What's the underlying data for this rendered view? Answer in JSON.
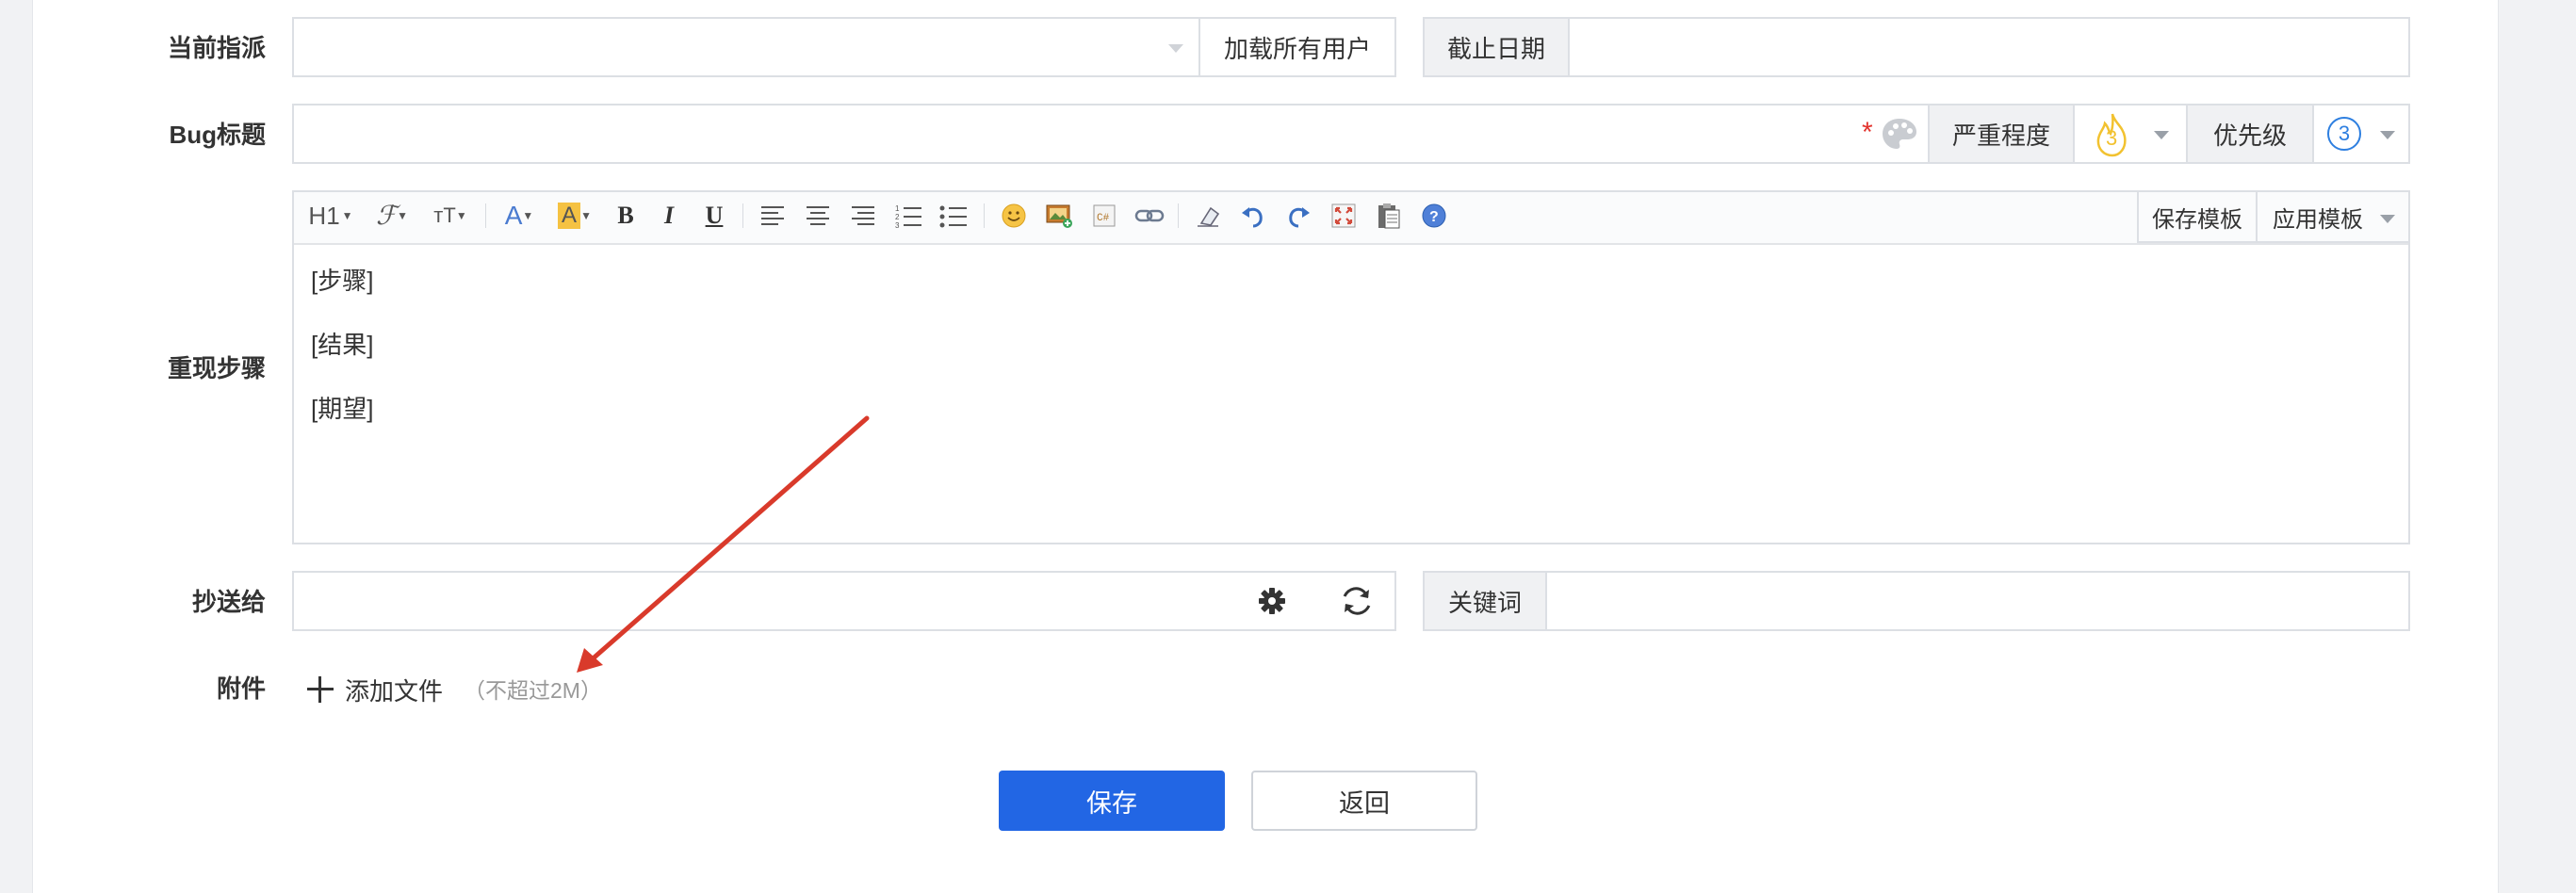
{
  "colors": {
    "primary": "#2266e4",
    "required": "#e2322c",
    "annotation_arrow": "#d93a2b",
    "priority_blue": "#2e7fe0",
    "severity_yellow": "#f2c230"
  },
  "assign": {
    "label": "当前指派",
    "select_value": "",
    "load_all_users": "加载所有用户",
    "deadline_label": "截止日期",
    "deadline_value": ""
  },
  "title_row": {
    "label": "Bug标题",
    "value": "",
    "required_mark": "*",
    "severity_label": "严重程度",
    "severity_value": "3",
    "priority_label": "优先级",
    "priority_value": "3"
  },
  "steps": {
    "label": "重现步骤",
    "toolbar": {
      "heading": "H1",
      "save_template": "保存模板",
      "apply_template": "应用模板"
    },
    "content": [
      "[步骤]",
      "[结果]",
      "[期望]"
    ]
  },
  "cc": {
    "label": "抄送给",
    "value": "",
    "keywords_label": "关键词",
    "keywords_value": ""
  },
  "attachment": {
    "label": "附件",
    "add_file": "添加文件",
    "limit_note": "（不超过2M）"
  },
  "actions": {
    "save": "保存",
    "back": "返回"
  },
  "icons": [
    "chevron-down-icon",
    "heading-icon",
    "font-family-icon",
    "font-size-icon",
    "font-color-icon",
    "highlight-icon",
    "bold-icon",
    "italic-icon",
    "underline-icon",
    "align-left-icon",
    "align-center-icon",
    "align-right-icon",
    "ordered-list-icon",
    "unordered-list-icon",
    "emoticon-icon",
    "image-icon",
    "code-icon",
    "link-icon",
    "clear-format-icon",
    "undo-icon",
    "redo-icon",
    "fullscreen-icon",
    "paste-icon",
    "help-icon",
    "palette-icon",
    "fire-icon",
    "gear-icon",
    "refresh-icon",
    "plus-icon"
  ]
}
